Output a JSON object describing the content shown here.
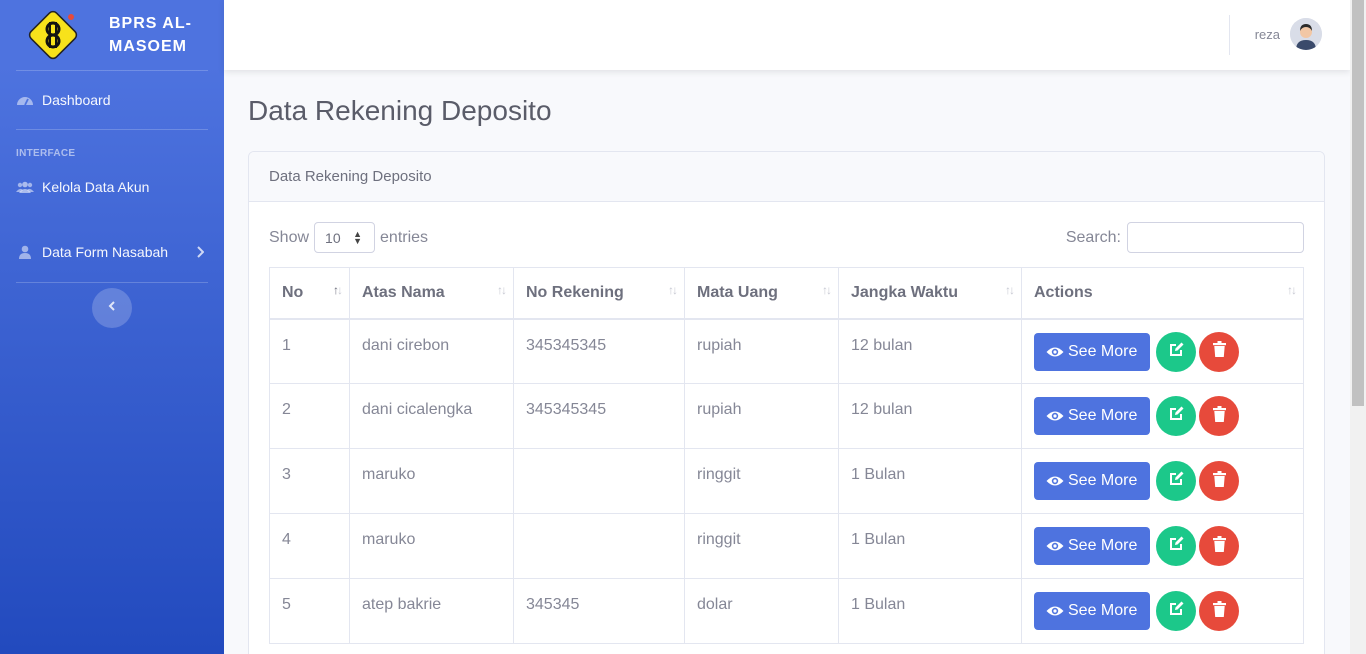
{
  "brand": {
    "name": "BPRS AL-MASOEM"
  },
  "sidebar": {
    "items": [
      {
        "label": "Dashboard",
        "icon": "tachometer-icon"
      },
      {
        "label": "Kelola Data Akun",
        "icon": "users-icon"
      },
      {
        "label": "Data Form Nasabah",
        "icon": "user-icon"
      }
    ],
    "heading": "INTERFACE"
  },
  "topbar": {
    "username": "reza"
  },
  "page": {
    "title": "Data Rekening Deposito"
  },
  "card": {
    "header": "Data Rekening Deposito"
  },
  "controls": {
    "show_label": "Show",
    "entries_value": "10",
    "entries_label": "entries",
    "search_label": "Search:",
    "search_value": ""
  },
  "table": {
    "columns": [
      "No",
      "Atas Nama",
      "No Rekening",
      "Mata Uang",
      "Jangka Waktu",
      "Actions"
    ],
    "rows": [
      {
        "no": "1",
        "nama": "dani cirebon",
        "rekening": "345345345",
        "uang": "rupiah",
        "waktu": "12 bulan"
      },
      {
        "no": "2",
        "nama": "dani cicalengka",
        "rekening": "345345345",
        "uang": "rupiah",
        "waktu": "12 bulan"
      },
      {
        "no": "3",
        "nama": "maruko",
        "rekening": "",
        "uang": "ringgit",
        "waktu": "1 Bulan"
      },
      {
        "no": "4",
        "nama": "maruko",
        "rekening": "",
        "uang": "ringgit",
        "waktu": "1 Bulan"
      },
      {
        "no": "5",
        "nama": "atep bakrie",
        "rekening": "345345",
        "uang": "dolar",
        "waktu": "1 Bulan"
      }
    ],
    "see_more_label": "See More"
  },
  "colors": {
    "primary": "#4e73df",
    "success": "#1cc88a",
    "danger": "#e74a3b"
  }
}
